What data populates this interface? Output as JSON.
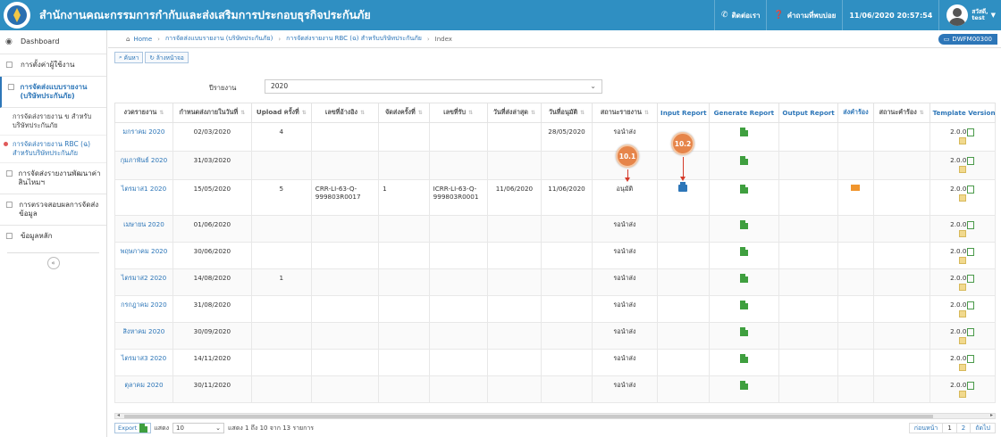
{
  "app": {
    "title": "สำนักงานคณะกรรมการกำกับและส่งเสริมการประกอบธุรกิจประกันภัย",
    "contact_label": "ติดต่อเรา",
    "staff_label": "คำถามที่พบบ่อย",
    "datetime": "11/06/2020 20:57:54",
    "user_name_line1": "สวัสดี,",
    "user_name_line2": "test"
  },
  "sidebar": {
    "dashboard": "Dashboard",
    "items": [
      {
        "label": "การตั้งค่าผู้ใช้งาน"
      },
      {
        "label": "การจัดส่งแบบรายงาน (บริษัทประกันภัย)"
      },
      {
        "label": "การจัดส่งรายงานพัฒนาค่าสินไหมฯ"
      },
      {
        "label": "การตรวจสอบผลการจัดส่งข้อมูล"
      },
      {
        "label": "ข้อมูลหลัก"
      }
    ],
    "sub_items": [
      {
        "label": "การจัดส่งรายงาน ข สำหรับบริษัทประกันภัย"
      },
      {
        "label": "การจัดส่งรายงาน RBC (ฉ) สำหรับบริษัทประกันภัย"
      }
    ],
    "collapse": "«"
  },
  "breadcrumb": {
    "home": "Home",
    "c1": "การจัดส่งแบบรายงาน (บริษัทประกันภัย)",
    "c2": "การจัดส่งรายงาน RBC (ฉ) สำหรับบริษัทประกันภัย",
    "c3": "Index",
    "badge": "DWFM00300"
  },
  "toolbar": {
    "search": "ค้นหา",
    "clear": "ล้างหน้าจอ"
  },
  "filter": {
    "year_label": "ปีรายงาน",
    "year_value": "2020"
  },
  "table": {
    "headers": [
      "งวดรายงาน",
      "กำหนดส่งภายในวันที่",
      "Upload ครั้งที่",
      "เลขที่อ้างอิง",
      "จัดส่งครั้งที่",
      "เลขที่รับ",
      "วันที่ส่งล่าสุด",
      "วันที่อนุมัติ",
      "สถานะรายงาน",
      "Input Report",
      "Generate Report",
      "Output Report",
      "ส่งคำร้อง",
      "สถานะคำร้อง",
      "Template Version"
    ],
    "rows": [
      {
        "period": "มกราคม 2020",
        "due": "02/03/2020",
        "upload": "4",
        "ref": "",
        "send": "",
        "recv": "",
        "last": "",
        "approve": "28/05/2020",
        "status": "รอนำส่ง",
        "version": "2.0.0"
      },
      {
        "period": "กุมภาพันธ์ 2020",
        "due": "31/03/2020",
        "upload": "",
        "ref": "",
        "send": "",
        "recv": "",
        "last": "",
        "approve": "",
        "status": "",
        "version": "2.0.0"
      },
      {
        "period": "ไตรมาส1 2020",
        "due": "15/05/2020",
        "upload": "5",
        "ref": "CRR-LI-63-Q-999803R0017",
        "send": "1",
        "recv": "ICRR-LI-63-Q-999803R0001",
        "last": "11/06/2020",
        "approve": "11/06/2020",
        "status": "อนุมัติ",
        "version": "2.0.0"
      },
      {
        "period": "เมษายน 2020",
        "due": "01/06/2020",
        "upload": "",
        "ref": "",
        "send": "",
        "recv": "",
        "last": "",
        "approve": "",
        "status": "รอนำส่ง",
        "version": "2.0.0"
      },
      {
        "period": "พฤษภาคม 2020",
        "due": "30/06/2020",
        "upload": "",
        "ref": "",
        "send": "",
        "recv": "",
        "last": "",
        "approve": "",
        "status": "รอนำส่ง",
        "version": "2.0.0"
      },
      {
        "period": "ไตรมาส2 2020",
        "due": "14/08/2020",
        "upload": "1",
        "ref": "",
        "send": "",
        "recv": "",
        "last": "",
        "approve": "",
        "status": "รอนำส่ง",
        "version": "2.0.0"
      },
      {
        "period": "กรกฎาคม 2020",
        "due": "31/08/2020",
        "upload": "",
        "ref": "",
        "send": "",
        "recv": "",
        "last": "",
        "approve": "",
        "status": "รอนำส่ง",
        "version": "2.0.0"
      },
      {
        "period": "สิงหาคม 2020",
        "due": "30/09/2020",
        "upload": "",
        "ref": "",
        "send": "",
        "recv": "",
        "last": "",
        "approve": "",
        "status": "รอนำส่ง",
        "version": "2.0.0"
      },
      {
        "period": "ไตรมาส3 2020",
        "due": "14/11/2020",
        "upload": "",
        "ref": "",
        "send": "",
        "recv": "",
        "last": "",
        "approve": "",
        "status": "รอนำส่ง",
        "version": "2.0.0"
      },
      {
        "period": "ตุลาคม 2020",
        "due": "30/11/2020",
        "upload": "",
        "ref": "",
        "send": "",
        "recv": "",
        "last": "",
        "approve": "",
        "status": "รอนำส่ง",
        "version": "2.0.0"
      }
    ]
  },
  "callouts": {
    "c1": "10.1",
    "c2": "10.2"
  },
  "footer": {
    "export": "Export",
    "show": "แสดง",
    "page_size": "10",
    "summary": "แสดง 1 ถึง 10 จาก 13 รายการ",
    "prev": "ก่อนหน้า",
    "p1": "1",
    "p2": "2",
    "next": "ถัดไป"
  },
  "colors": {
    "header_bg": "#2f8fc2",
    "accent": "#2d76b8",
    "callout": "#e6854a",
    "arrow": "#d43a2a"
  }
}
